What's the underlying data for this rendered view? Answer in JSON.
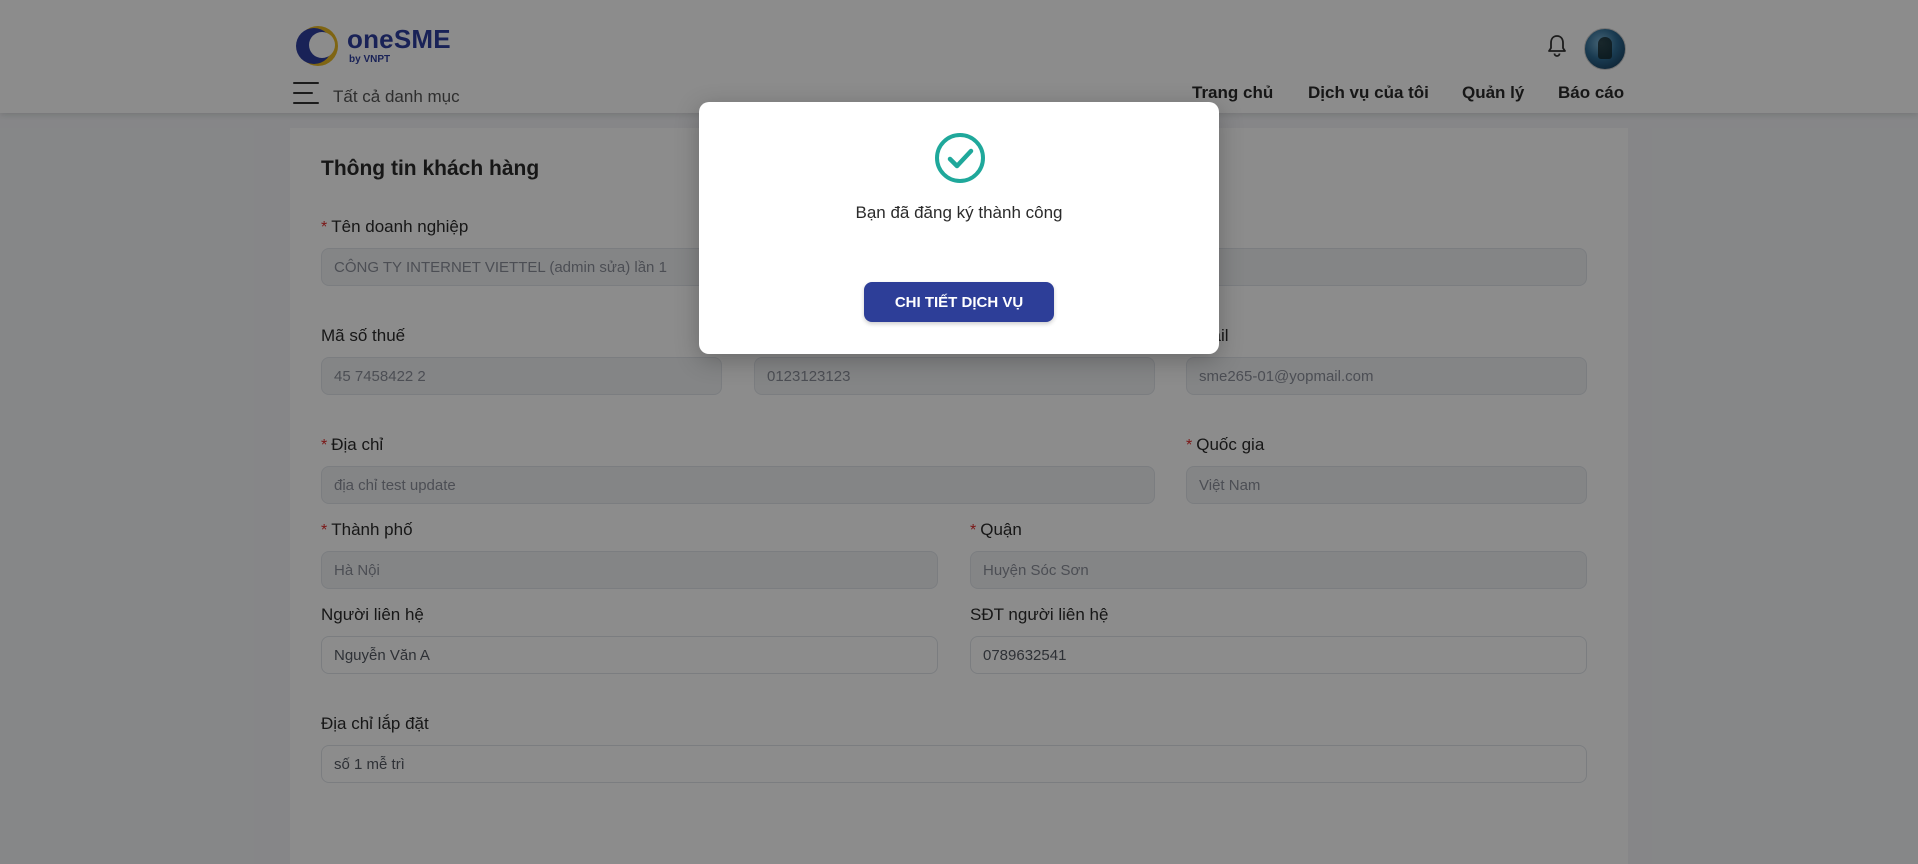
{
  "header": {
    "logo_text": "oneSME",
    "logo_sub": "by VNPT",
    "all_categories": "Tất cả danh mục",
    "nav": [
      "Trang chủ",
      "Dịch vụ của tôi",
      "Quản lý",
      "Báo cáo"
    ]
  },
  "form": {
    "title": "Thông tin khách hàng",
    "required_mark": "*",
    "fields": {
      "company_name": {
        "label": "Tên doanh nghiệp",
        "value": "CÔNG TY INTERNET VIETTEL (admin sửa) lần 1"
      },
      "tax_code": {
        "label": "Mã số thuế",
        "value": "45 7458422 2"
      },
      "phone": {
        "value": "0123123123"
      },
      "email": {
        "label": "Email",
        "value": "sme265-01@yopmail.com"
      },
      "address": {
        "label": "Địa chỉ",
        "value": "địa chỉ test update"
      },
      "country": {
        "label": "Quốc gia",
        "value": "Việt Nam"
      },
      "city": {
        "label": "Thành phố",
        "value": "Hà Nội"
      },
      "district": {
        "label": "Quận",
        "value": "Huyện Sóc Sơn"
      },
      "contact_person": {
        "label": "Người liên hệ",
        "value": "Nguyễn Văn A"
      },
      "contact_phone": {
        "label": "SĐT người liên hệ",
        "value": "0789632541"
      },
      "install_address": {
        "label": "Địa chỉ lắp đặt",
        "value": "số 1 mễ trì"
      }
    }
  },
  "modal": {
    "message": "Bạn đã đăng ký thành công",
    "button": "CHI TIẾT DỊCH VỤ",
    "icon": "check-circle-icon",
    "accent_color": "#1fa89b",
    "button_color": "#2d3e98"
  },
  "colors": {
    "brand": "#2f3e9e",
    "logo_accent": "#e8b923",
    "required": "#e02c2c"
  }
}
